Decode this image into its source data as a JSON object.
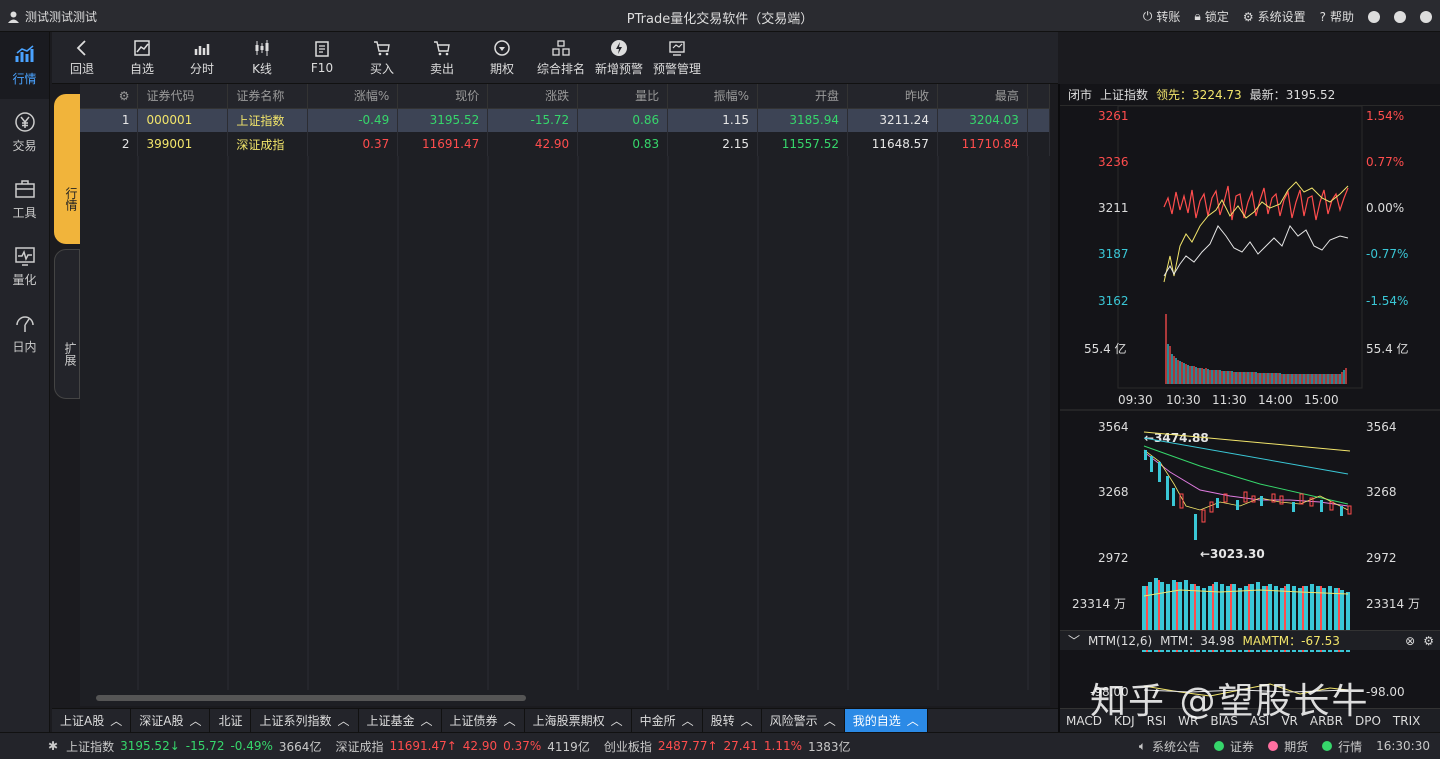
{
  "titlebar": {
    "user": "测试测试测试",
    "title": "PTrade量化交易软件（交易端）",
    "actions": [
      "转账",
      "锁定",
      "系统设置",
      "帮助"
    ]
  },
  "nav": [
    {
      "label": "行情",
      "icon": "chart-bar-icon",
      "active": true
    },
    {
      "label": "交易",
      "icon": "yen-icon"
    },
    {
      "label": "工具",
      "icon": "briefcase-icon"
    },
    {
      "label": "量化",
      "icon": "monitor-wave-icon"
    },
    {
      "label": "日内",
      "icon": "gauge-icon"
    }
  ],
  "toolbar": [
    "回退",
    "自选",
    "分时",
    "K线",
    "F10",
    "买入",
    "卖出",
    "期权",
    "综合排名",
    "新增预警",
    "预警管理"
  ],
  "sidetabs": [
    "行情",
    "扩展"
  ],
  "table": {
    "headers": [
      "证券代码",
      "证券名称",
      "涨幅%",
      "现价",
      "涨跌",
      "量比",
      "振幅%",
      "开盘",
      "昨收",
      "最高"
    ],
    "rows": [
      {
        "idx": "1",
        "code": "000001",
        "name": "上证指数",
        "pct": "-0.49",
        "price": "3195.52",
        "chg": "-15.72",
        "vr": "0.86",
        "amp": "1.15",
        "open": "3185.94",
        "prev": "3211.24",
        "high": "3204.03"
      },
      {
        "idx": "2",
        "code": "399001",
        "name": "深证成指",
        "pct": "0.37",
        "price": "11691.47",
        "chg": "42.90",
        "vr": "0.83",
        "amp": "2.15",
        "open": "11557.52",
        "prev": "11648.57",
        "high": "11710.84"
      }
    ]
  },
  "bottomtabs": [
    "上证A股",
    "深证A股",
    "北证",
    "上证系列指数",
    "上证基金",
    "上证债券",
    "上海股票期权",
    "中金所",
    "股转",
    "风险警示",
    "我的自选"
  ],
  "status": {
    "sh_name": "上证指数",
    "sh_price": "3195.52",
    "sh_chg": "-15.72",
    "sh_pct": "-0.49%",
    "sh_vol": "3664亿",
    "sz_name": "深证成指",
    "sz_price": "11691.47",
    "sz_chg": "42.90",
    "sz_pct": "0.37%",
    "sz_vol": "4119亿",
    "cy_name": "创业板指",
    "cy_price": "2487.77",
    "cy_chg": "27.41",
    "cy_pct": "1.11%",
    "cy_vol": "1383亿",
    "notice": "系统公告",
    "sec": "证券",
    "fut": "期货",
    "quote": "行情",
    "time": "16:30:30"
  },
  "right": {
    "status": "闭市",
    "name": "上证指数",
    "lead_label": "领先：",
    "lead": "3224.73",
    "latest_label": "最新：",
    "latest": "3195.52",
    "intraday_left": [
      "3261",
      "3236",
      "3211",
      "3187",
      "3162"
    ],
    "intraday_right": [
      "1.54%",
      "0.77%",
      "0.00%",
      "-0.77%",
      "-1.54%"
    ],
    "vol_label": "55.4 亿",
    "times": [
      "09:30",
      "10:30",
      "11:30",
      "14:00",
      "15:00"
    ],
    "k_left": [
      "3564",
      "3268",
      "2972"
    ],
    "k_right": [
      "3564",
      "3268",
      "2972"
    ],
    "k_high": "←3474.88",
    "k_low": "←3023.30",
    "kvol_label": "23314 万",
    "mtm_title": "MTM(12,6)",
    "mtm_val_label": "MTM：",
    "mtm_val": "34.98",
    "mamtm_label": "MAMTM：",
    "mamtm_val": "-67.53",
    "mtm_axis": "-98.00",
    "mtm_axis2": "-98.00",
    "indicators": [
      "MACD",
      "KDJ",
      "RSI",
      "WR",
      "BIAS",
      "ASI",
      "VR",
      "ARBR",
      "DPO",
      "TRIX"
    ]
  },
  "watermark": "知乎 @望股长牛",
  "colors": {
    "up": "#ff4d4d",
    "down": "#36d66b",
    "accent": "#2b8ae6",
    "tab": "#f1b43b"
  }
}
